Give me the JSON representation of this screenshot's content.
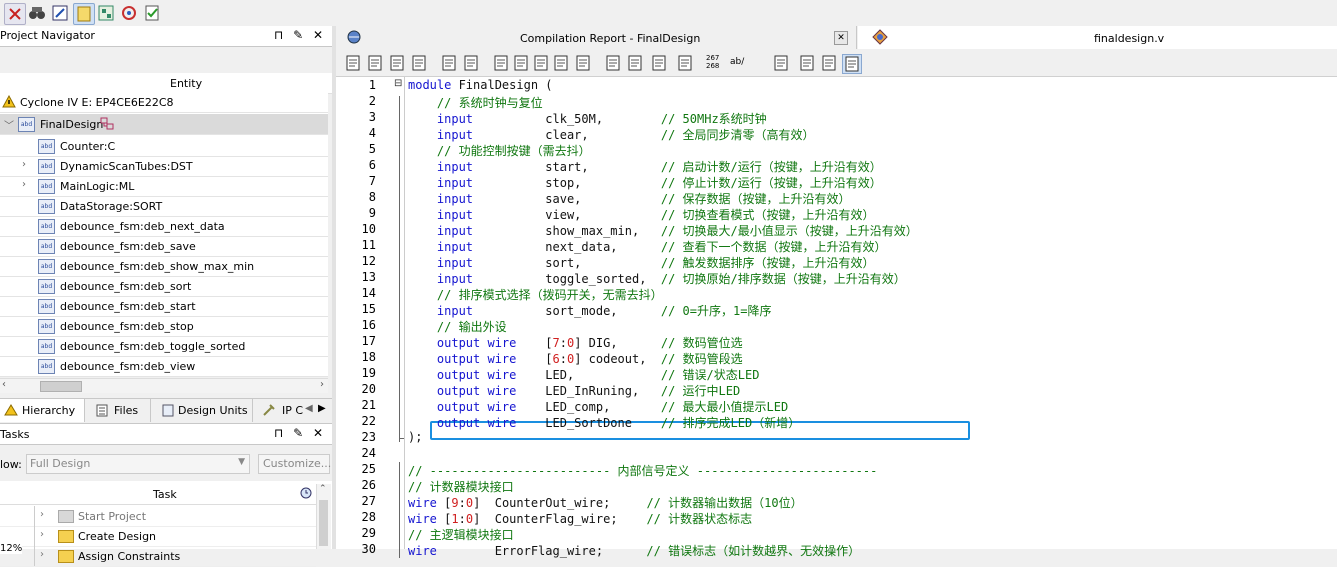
{
  "left_panel": {
    "navigator_title": "Project Navigator",
    "entity_header": "Entity",
    "device": "Cyclone IV E: EP4CE6E22C8",
    "top_entity": "FinalDesign",
    "hierarchy": [
      "Counter:C",
      "DynamicScanTubes:DST",
      "MainLogic:ML",
      "DataStorage:SORT",
      "debounce_fsm:deb_next_data",
      "debounce_fsm:deb_save",
      "debounce_fsm:deb_show_max_min",
      "debounce_fsm:deb_sort",
      "debounce_fsm:deb_start",
      "debounce_fsm:deb_stop",
      "debounce_fsm:deb_toggle_sorted",
      "debounce_fsm:deb_view"
    ],
    "tabs": [
      "Hierarchy",
      "Files",
      "Design Units",
      "IP C"
    ],
    "tasks_title": "Tasks",
    "flow_label": "low:",
    "flow_value": "Full Design",
    "customize_label": "Customize...",
    "task_column": "Task",
    "tasks": [
      "Start Project",
      "Create Design",
      "Assign Constraints"
    ],
    "zoom": "12%"
  },
  "editor": {
    "tab_report": "Compilation Report - FinalDesign",
    "tab_file": "finaldesign.v",
    "toolbar_text_a": "267\n268",
    "toolbar_text_b": "ab/",
    "lines": [
      {
        "n": "1",
        "parts": [
          [
            "kw",
            "module"
          ],
          [
            "tx",
            " FinalDesign ("
          ]
        ]
      },
      {
        "n": "2",
        "parts": [
          [
            "cm",
            "    // 系统时钟与复位"
          ]
        ]
      },
      {
        "n": "3",
        "parts": [
          [
            "kw",
            "    input"
          ],
          [
            "tx",
            "          clk_50M,        "
          ],
          [
            "cm",
            "// 50MHz系统时钟"
          ]
        ]
      },
      {
        "n": "4",
        "parts": [
          [
            "kw",
            "    input"
          ],
          [
            "tx",
            "          clear,          "
          ],
          [
            "cm",
            "// 全局同步清零（高有效）"
          ]
        ]
      },
      {
        "n": "5",
        "parts": [
          [
            "cm",
            "    // 功能控制按键（需去抖）"
          ]
        ]
      },
      {
        "n": "6",
        "parts": [
          [
            "kw",
            "    input"
          ],
          [
            "tx",
            "          start,          "
          ],
          [
            "cm",
            "// 启动计数/运行（按键，上升沿有效）"
          ]
        ]
      },
      {
        "n": "7",
        "parts": [
          [
            "kw",
            "    input"
          ],
          [
            "tx",
            "          stop,           "
          ],
          [
            "cm",
            "// 停止计数/运行（按键，上升沿有效）"
          ]
        ]
      },
      {
        "n": "8",
        "parts": [
          [
            "kw",
            "    input"
          ],
          [
            "tx",
            "          save,           "
          ],
          [
            "cm",
            "// 保存数据（按键，上升沿有效）"
          ]
        ]
      },
      {
        "n": "9",
        "parts": [
          [
            "kw",
            "    input"
          ],
          [
            "tx",
            "          view,           "
          ],
          [
            "cm",
            "// 切换查看模式（按键，上升沿有效）"
          ]
        ]
      },
      {
        "n": "10",
        "parts": [
          [
            "kw",
            "    input"
          ],
          [
            "tx",
            "          show_max_min,   "
          ],
          [
            "cm",
            "// 切换最大/最小值显示（按键，上升沿有效）"
          ]
        ]
      },
      {
        "n": "11",
        "parts": [
          [
            "kw",
            "    input"
          ],
          [
            "tx",
            "          next_data,      "
          ],
          [
            "cm",
            "// 查看下一个数据（按键，上升沿有效）"
          ]
        ]
      },
      {
        "n": "12",
        "parts": [
          [
            "kw",
            "    input"
          ],
          [
            "tx",
            "          sort,           "
          ],
          [
            "cm",
            "// 触发数据排序（按键，上升沿有效）"
          ]
        ]
      },
      {
        "n": "13",
        "parts": [
          [
            "kw",
            "    input"
          ],
          [
            "tx",
            "          toggle_sorted,  "
          ],
          [
            "cm",
            "// 切换原始/排序数据（按键，上升沿有效）"
          ]
        ]
      },
      {
        "n": "14",
        "parts": [
          [
            "cm",
            "    // 排序模式选择（拨码开关，无需去抖）"
          ]
        ]
      },
      {
        "n": "15",
        "parts": [
          [
            "kw",
            "    input"
          ],
          [
            "tx",
            "          sort_mode,      "
          ],
          [
            "cm",
            "// 0=升序，1=降序"
          ]
        ]
      },
      {
        "n": "16",
        "parts": [
          [
            "cm",
            "    // 输出外设"
          ]
        ]
      },
      {
        "n": "17",
        "parts": [
          [
            "kw",
            "    output wire"
          ],
          [
            "tx",
            "    ["
          ],
          [
            "num",
            "7"
          ],
          [
            "tx",
            ":"
          ],
          [
            "num",
            "0"
          ],
          [
            "tx",
            "] DIG,      "
          ],
          [
            "cm",
            "// 数码管位选"
          ]
        ]
      },
      {
        "n": "18",
        "parts": [
          [
            "kw",
            "    output wire"
          ],
          [
            "tx",
            "    ["
          ],
          [
            "num",
            "6"
          ],
          [
            "tx",
            ":"
          ],
          [
            "num",
            "0"
          ],
          [
            "tx",
            "] codeout,  "
          ],
          [
            "cm",
            "// 数码管段选"
          ]
        ]
      },
      {
        "n": "19",
        "parts": [
          [
            "kw",
            "    output wire"
          ],
          [
            "tx",
            "    LED,            "
          ],
          [
            "cm",
            "// 错误/状态LED"
          ]
        ]
      },
      {
        "n": "20",
        "parts": [
          [
            "kw",
            "    output wire"
          ],
          [
            "tx",
            "    LED_InRuning,   "
          ],
          [
            "cm",
            "// 运行中LED"
          ]
        ]
      },
      {
        "n": "21",
        "parts": [
          [
            "kw",
            "    output wire"
          ],
          [
            "tx",
            "    LED_comp,       "
          ],
          [
            "cm",
            "// 最大最小值提示LED"
          ]
        ]
      },
      {
        "n": "22",
        "parts": [
          [
            "kw",
            "    output wire"
          ],
          [
            "tx",
            "    LED_SortDone    "
          ],
          [
            "cm",
            "// 排序完成LED（新增）"
          ]
        ]
      },
      {
        "n": "23",
        "parts": [
          [
            "tx",
            ");"
          ]
        ]
      },
      {
        "n": "24",
        "parts": [
          [
            "tx",
            ""
          ]
        ]
      },
      {
        "n": "25",
        "parts": [
          [
            "cm",
            "// ------------------------- 内部信号定义 -------------------------"
          ]
        ]
      },
      {
        "n": "26",
        "parts": [
          [
            "cm",
            "// 计数器模块接口"
          ]
        ]
      },
      {
        "n": "27",
        "parts": [
          [
            "kw",
            "wire"
          ],
          [
            "tx",
            " ["
          ],
          [
            "num",
            "9"
          ],
          [
            "tx",
            ":"
          ],
          [
            "num",
            "0"
          ],
          [
            "tx",
            "]  CounterOut_wire;     "
          ],
          [
            "cm",
            "// 计数器输出数据（10位）"
          ]
        ]
      },
      {
        "n": "28",
        "parts": [
          [
            "kw",
            "wire"
          ],
          [
            "tx",
            " ["
          ],
          [
            "num",
            "1"
          ],
          [
            "tx",
            ":"
          ],
          [
            "num",
            "0"
          ],
          [
            "tx",
            "]  CounterFlag_wire;    "
          ],
          [
            "cm",
            "// 计数器状态标志"
          ]
        ]
      },
      {
        "n": "29",
        "parts": [
          [
            "cm",
            "// 主逻辑模块接口"
          ]
        ]
      },
      {
        "n": "30",
        "parts": [
          [
            "kw",
            "wire"
          ],
          [
            "tx",
            "        ErrorFlag_wire;      "
          ],
          [
            "cm",
            "// 错误标志（如计数越界、无效操作）"
          ]
        ]
      }
    ]
  },
  "colors": {
    "keyword": "#1515d0",
    "comment": "#107710",
    "highlight": "#1a8fe0"
  }
}
